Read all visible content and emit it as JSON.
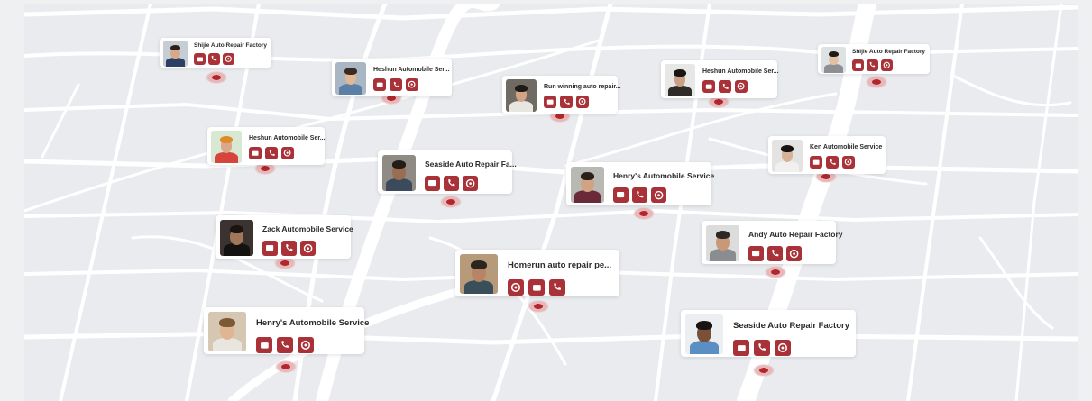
{
  "map": {
    "colors": {
      "background": "#e9ebee",
      "road": "#ffffff",
      "accent": "#a83238",
      "pin": "#b3262d"
    },
    "listings": [
      {
        "id": "shijie-1",
        "name": "Shijie Auto Repair Factory",
        "actions": [
          "message-icon",
          "phone-icon",
          "chat-icon"
        ],
        "avatar": {
          "bg": "#c7cdd4",
          "hair": "#2a211c",
          "skin": "#d8a88a",
          "shirt": "#2c3e63"
        }
      },
      {
        "id": "heshun-1",
        "name": "Heshun Automobile Ser...",
        "actions": [
          "message-icon",
          "phone-icon",
          "chat-icon"
        ],
        "avatar": {
          "bg": "#a9b7c4",
          "hair": "#3b2a1e",
          "skin": "#e0b894",
          "shirt": "#5c7fa6"
        }
      },
      {
        "id": "run-winning",
        "name": "Run winning auto repair...",
        "actions": [
          "message-icon",
          "phone-icon",
          "chat-icon"
        ],
        "avatar": {
          "bg": "#6f6a62",
          "hair": "#1e1a17",
          "skin": "#d2a486",
          "shirt": "#e8e6e1"
        }
      },
      {
        "id": "heshun-2",
        "name": "Heshun Automobile Ser...",
        "actions": [
          "message-icon",
          "phone-icon",
          "chat-icon"
        ],
        "avatar": {
          "bg": "#e7e7e5",
          "hair": "#181512",
          "skin": "#caa086",
          "shirt": "#2f2b28"
        }
      },
      {
        "id": "shijie-2",
        "name": "Shijie Auto Repair Factory",
        "actions": [
          "message-icon",
          "phone-icon",
          "chat-icon"
        ],
        "avatar": {
          "bg": "#dfe2e3",
          "hair": "#1f1a16",
          "skin": "#e3c0a4",
          "shirt": "#8c8f93"
        }
      },
      {
        "id": "heshun-3",
        "name": "Heshun Automobile Ser...",
        "actions": [
          "message-icon",
          "phone-icon",
          "chat-icon"
        ],
        "avatar": {
          "bg": "#d9e8d2",
          "hair": "#e08a2a",
          "skin": "#d9a78a",
          "shirt": "#d8443b"
        }
      },
      {
        "id": "seaside-1",
        "name": "Seaside Auto Repair Fa...",
        "actions": [
          "message-icon",
          "phone-icon",
          "chat-icon"
        ],
        "avatar": {
          "bg": "#8f8a84",
          "hair": "#231c17",
          "skin": "#9b6e52",
          "shirt": "#3b4a5c"
        }
      },
      {
        "id": "henrys-1",
        "name": "Henry's Automobile Service",
        "actions": [
          "message-icon",
          "phone-icon",
          "chat-icon"
        ],
        "avatar": {
          "bg": "#b8b9b2",
          "hair": "#2a2019",
          "skin": "#d1a283",
          "shirt": "#6a2a3a"
        }
      },
      {
        "id": "ken",
        "name": "Ken Automobile Service",
        "actions": [
          "message-icon",
          "phone-icon",
          "chat-icon"
        ],
        "avatar": {
          "bg": "#e3e3e1",
          "hair": "#161311",
          "skin": "#d8b296",
          "shirt": "#f1f0ee"
        }
      },
      {
        "id": "zack",
        "name": "Zack Automobile Service",
        "actions": [
          "message-icon",
          "phone-icon",
          "chat-icon"
        ],
        "avatar": {
          "bg": "#3a3330",
          "hair": "#1a1512",
          "skin": "#a1765b",
          "shirt": "#141210"
        }
      },
      {
        "id": "andy",
        "name": "Andy Auto Repair Factory",
        "actions": [
          "message-icon",
          "phone-icon",
          "chat-icon"
        ],
        "avatar": {
          "bg": "#dcdcdc",
          "hair": "#2e2824",
          "skin": "#c89878",
          "shirt": "#8a8d90"
        }
      },
      {
        "id": "homerun",
        "name": "Homerun auto repair pe...",
        "actions": [
          "chat-icon",
          "message-icon",
          "phone-icon"
        ],
        "avatar": {
          "bg": "#b69a7a",
          "hair": "#2c241e",
          "skin": "#b78566",
          "shirt": "#3b4f5a"
        }
      },
      {
        "id": "henrys-2",
        "name": "Henry's Automobile Service",
        "actions": [
          "message-icon",
          "phone-icon",
          "chat-icon"
        ],
        "avatar": {
          "bg": "#d6c7b3",
          "hair": "#7a5a36",
          "skin": "#e0b594",
          "shirt": "#e9e5df"
        }
      },
      {
        "id": "seaside-2",
        "name": "Seaside Auto Repair Factory",
        "actions": [
          "message-icon",
          "phone-icon",
          "chat-icon"
        ],
        "avatar": {
          "bg": "#eceff1",
          "hair": "#1b1512",
          "skin": "#7a5038",
          "shirt": "#5b8fc4"
        }
      }
    ]
  }
}
